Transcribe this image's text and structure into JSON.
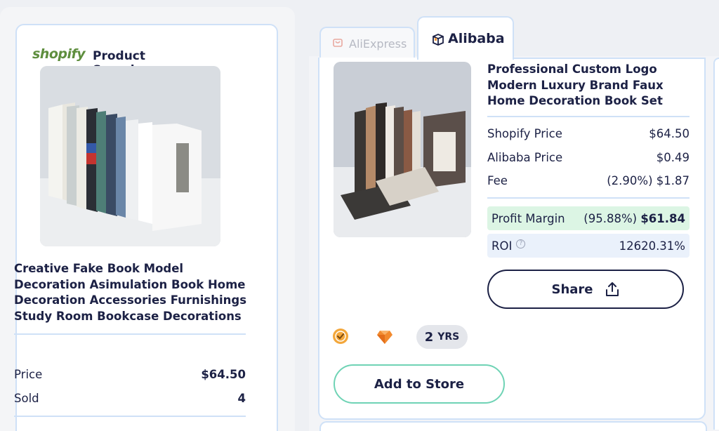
{
  "left": {
    "brand": "shopify",
    "heading": "Product Search by Image",
    "product_title": "Creative Fake Book Model Decoration Asimulation Book Home Decoration Accessories Furnishings Study Room Bookcase Decorations",
    "price_label": "Price",
    "price_value": "$64.50",
    "sold_label": "Sold",
    "sold_value": "4"
  },
  "tabs": [
    {
      "label": "AliExpress",
      "active": false,
      "icon": "aliexpress-icon"
    },
    {
      "label": "Alibaba",
      "active": true,
      "icon": "alibaba-icon"
    }
  ],
  "right": {
    "product_title": "Professional Custom Logo Modern Luxury Brand Faux Home Decoration Book Set",
    "rows": [
      {
        "label": "Shopify Price",
        "value": "$64.50"
      },
      {
        "label": "Alibaba Price",
        "value": "$0.49"
      },
      {
        "label": "Fee",
        "value": "(2.90%) $1.87"
      }
    ],
    "profit_label": "Profit Margin",
    "profit_pct": "(95.88%)",
    "profit_value": "$61.84",
    "roi_label": "ROI",
    "roi_value": "12620.31%",
    "share_label": "Share",
    "years_number": "2",
    "years_unit": "YRS",
    "add_label": "Add to Store"
  },
  "colors": {
    "navy": "#1c2145",
    "card_border": "#cfe1f7",
    "profit_bg": "#dcf5e4",
    "roi_bg": "#eaf1fb",
    "add_border": "#6fd3b5",
    "shopify_green": "#5e8e3e"
  }
}
